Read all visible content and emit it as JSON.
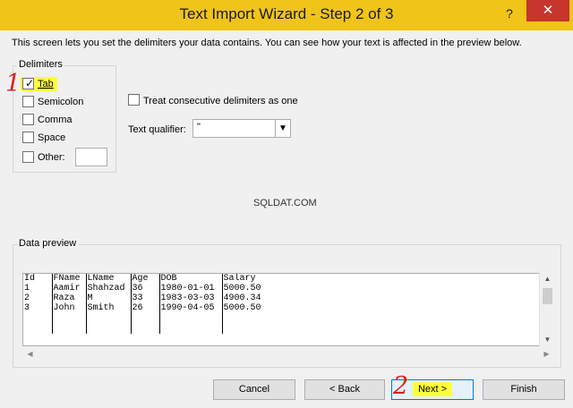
{
  "window": {
    "title": "Text Import Wizard - Step 2 of 3",
    "help_label": "?",
    "close_label": "✕"
  },
  "intro_text": "This screen lets you set the delimiters your data contains.  You can see how your text is affected in the preview below.",
  "delimiters": {
    "group_label": "Delimiters",
    "tab_label": "Tab",
    "tab_checked": true,
    "semicolon_label": "Semicolon",
    "comma_label": "Comma",
    "space_label": "Space",
    "other_label": "Other:",
    "other_value": ""
  },
  "options": {
    "consecutive_label": "Treat consecutive delimiters as one",
    "qualifier_label": "Text qualifier:",
    "qualifier_value": "\""
  },
  "watermark": "SQLDAT.COM",
  "preview": {
    "group_label": "Data preview",
    "headers": [
      "Id",
      "FName",
      "LName",
      "Age",
      "DOB",
      "Salary"
    ],
    "rows": [
      [
        "1",
        "Aamir",
        "Shahzad",
        "36",
        "1980-01-01",
        "5000.50"
      ],
      [
        "2",
        "Raza",
        "M",
        "33",
        "1983-03-03",
        "4900.34"
      ],
      [
        "3",
        "John",
        "Smith",
        "26",
        "1990-04-05",
        "5000.50"
      ]
    ]
  },
  "buttons": {
    "cancel": "Cancel",
    "back": "< Back",
    "next": "Next >",
    "finish": "Finish"
  },
  "annotations": {
    "step1": "1",
    "step2": "2"
  },
  "colors": {
    "titlebar": "#f0c419",
    "highlight": "#ffff3c",
    "annotation": "#e01d1d",
    "close": "#c7352c"
  }
}
